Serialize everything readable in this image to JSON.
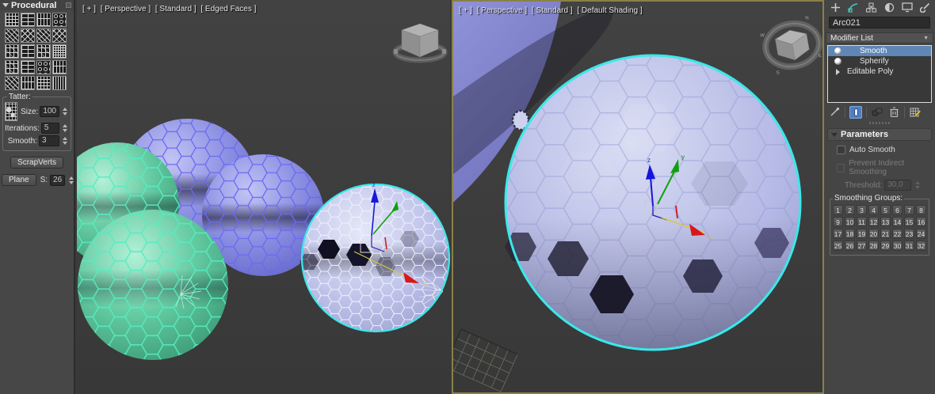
{
  "colors": {
    "accent-teal": "#49c8b8",
    "selection-blue": "#5f86b5",
    "active-viewport-border": "#8a8146",
    "selection-outline": "#3ae8ea"
  },
  "left_panel": {
    "title": "Procedural",
    "patterns": [
      "grid",
      "brick",
      "planks",
      "honeycomb",
      "weave",
      "lattice",
      "diagonal",
      "diamond",
      "patch",
      "blocks",
      "checker",
      "dense-grid",
      "maze",
      "tiles",
      "scatter",
      "columns",
      "waves",
      "bars",
      "mesh",
      "stripes"
    ],
    "tatter": {
      "title": "Tatter:",
      "size_label": "Size:",
      "size_value": "100",
      "iterations_label": "Iterations:",
      "iterations_value": "5",
      "smooth_label": "Smooth:",
      "smooth_value": "3"
    },
    "scrapverts_button": "ScrapVerts",
    "plane_button": "Plane",
    "s_label": "S:",
    "s_value": "26"
  },
  "viewport_left": {
    "menus": [
      "[ + ]",
      "[ Perspective ]",
      "[ Standard ]",
      "[ Edged Faces ]"
    ]
  },
  "viewport_right": {
    "menus": [
      "[ + ]",
      "[ Perspective ]",
      "[ Standard ]",
      "[ Default Shading ]"
    ]
  },
  "right_panel": {
    "object_name": "Arc021",
    "modifier_list_label": "Modifier List",
    "stack": [
      {
        "label": "Smooth",
        "selected": true
      },
      {
        "label": "Spherify",
        "selected": false
      },
      {
        "label": "Editable Poly",
        "selected": false
      }
    ],
    "parameters": {
      "title": "Parameters",
      "auto_smooth_label": "Auto Smooth",
      "prevent_label": "Prevent Indirect Smoothing",
      "threshold_label": "Threshold:",
      "threshold_value": "30,0",
      "smoothing_groups_label": "Smoothing Groups:",
      "smoothing_groups": [
        "1",
        "2",
        "3",
        "4",
        "5",
        "6",
        "7",
        "8",
        "9",
        "10",
        "11",
        "12",
        "13",
        "14",
        "15",
        "16",
        "17",
        "18",
        "19",
        "20",
        "21",
        "22",
        "23",
        "24",
        "25",
        "26",
        "27",
        "28",
        "29",
        "30",
        "31",
        "32"
      ]
    }
  }
}
